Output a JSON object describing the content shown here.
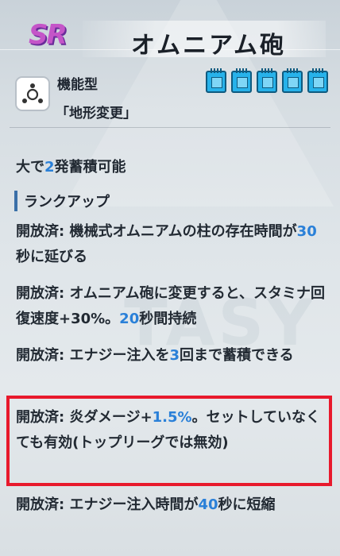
{
  "header": {
    "rarity": "SR",
    "title": "オムニアム砲"
  },
  "type": {
    "icon": "tri-node-icon",
    "label": "機能型",
    "sub": "「地形変更」"
  },
  "chips": [
    "chip-icon",
    "chip-icon",
    "chip-icon",
    "chip-icon",
    "chip-icon"
  ],
  "charge": {
    "pre": "大で",
    "num": "2",
    "post": "発蓄積可能"
  },
  "section_heading": "ランクアップ",
  "upgrades": [
    {
      "prefix": "開放済: 機械式オムニアムの柱の存在時間が",
      "num": "30",
      "suffix": "秒に延びる"
    },
    {
      "prefix": "開放済: オムニアム砲に変更すると、スタミナ回復速度+30%。",
      "num": "20",
      "suffix": "秒間持続"
    },
    {
      "prefix": "開放済: エナジー注入を",
      "num": "3",
      "suffix": "回まで蓄積できる"
    },
    {
      "prefix": "開放済: 炎ダメージ+",
      "num": "1.5%",
      "suffix": "。セットしていなくても有効(トップリーグでは無効)"
    },
    {
      "prefix": "開放済: エナジー注入時間が",
      "num": "40",
      "suffix": "秒に短縮"
    }
  ],
  "colors": {
    "highlight": "#2a80d8",
    "box": "#e8192c",
    "chip": "#27b2ea",
    "rarity": "#c455c8"
  }
}
